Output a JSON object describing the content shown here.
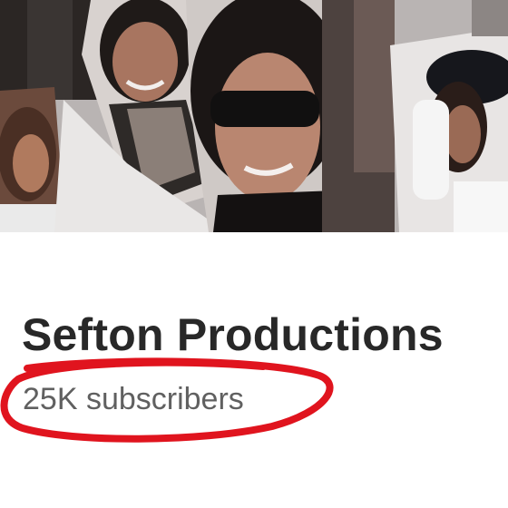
{
  "channel": {
    "name": "Sefton Productions",
    "subscribers": "25K subscribers"
  },
  "banner": {
    "image": "channel-banner-collage"
  },
  "annotation": {
    "color": "#e0141e",
    "shape": "hand-drawn-ellipse"
  },
  "colors": {
    "title": "#282828",
    "subtitle": "#606060",
    "background": "#ffffff"
  }
}
